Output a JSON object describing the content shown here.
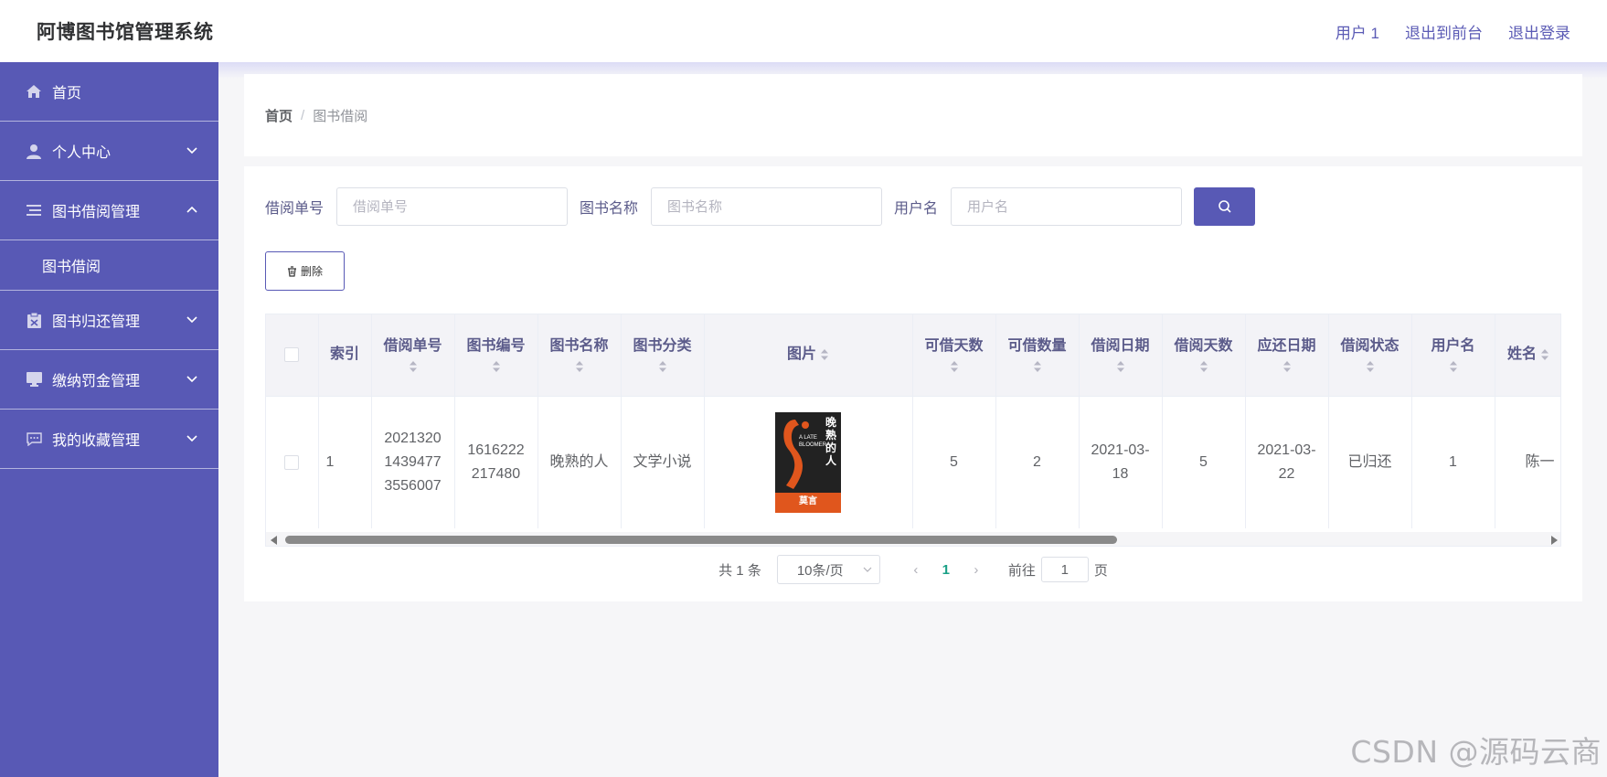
{
  "header": {
    "title": "阿博图书馆管理系统",
    "links": [
      "用户 1",
      "退出到前台",
      "退出登录"
    ]
  },
  "sidebar": {
    "items": [
      {
        "label": "首页",
        "icon": "home-icon"
      },
      {
        "label": "个人中心",
        "icon": "user-icon",
        "expanded": false
      },
      {
        "label": "图书借阅管理",
        "icon": "list-icon",
        "expanded": true,
        "children": [
          "图书借阅"
        ]
      },
      {
        "label": "图书归还管理",
        "icon": "clipboard-icon",
        "expanded": false
      },
      {
        "label": "缴纳罚金管理",
        "icon": "monitor-icon",
        "expanded": false
      },
      {
        "label": "我的收藏管理",
        "icon": "chat-icon",
        "expanded": false
      }
    ]
  },
  "breadcrumb": {
    "home": "首页",
    "separator": "/",
    "current": "图书借阅"
  },
  "search": {
    "fields": [
      {
        "label": "借阅单号",
        "placeholder": "借阅单号",
        "value": ""
      },
      {
        "label": "图书名称",
        "placeholder": "图书名称",
        "value": ""
      },
      {
        "label": "用户名",
        "placeholder": "用户名",
        "value": ""
      }
    ],
    "button_icon": "search-icon"
  },
  "actions": {
    "delete_label": "删除",
    "delete_icon": "trash-icon"
  },
  "table": {
    "columns": [
      "索引",
      "借阅单号",
      "图书编号",
      "图书名称",
      "图书分类",
      "图片",
      "可借天数",
      "可借数量",
      "借阅日期",
      "借阅天数",
      "应还日期",
      "借阅状态",
      "用户名",
      "姓名"
    ],
    "rows": [
      {
        "index": "1",
        "borrow_no": [
          "2021320",
          "1439477",
          "3556007"
        ],
        "book_no": [
          "1616222",
          "217480"
        ],
        "book_name": "晚熟的人",
        "category": "文学小说",
        "cover": {
          "title": "晚熟的人",
          "en_title": "A LATE BLOOMER",
          "author": "莫言"
        },
        "borrow_days_allowed": "5",
        "quantity": "2",
        "borrow_date": [
          "2021-03-",
          "18"
        ],
        "borrow_days": "5",
        "due_date": [
          "2021-03-",
          "22"
        ],
        "status": "已归还",
        "username": "1",
        "name": "陈一"
      }
    ]
  },
  "pagination": {
    "total": "共 1 条",
    "page_size": "10条/页",
    "prev": "‹",
    "current": "1",
    "next": "›",
    "goto_label": "前往",
    "goto_value": "1",
    "page_label": "页"
  },
  "watermark": "CSDN @源码云商",
  "colors": {
    "primary": "#5859b5",
    "active_page": "#19a086",
    "header_bg": "#f3f3f7"
  }
}
